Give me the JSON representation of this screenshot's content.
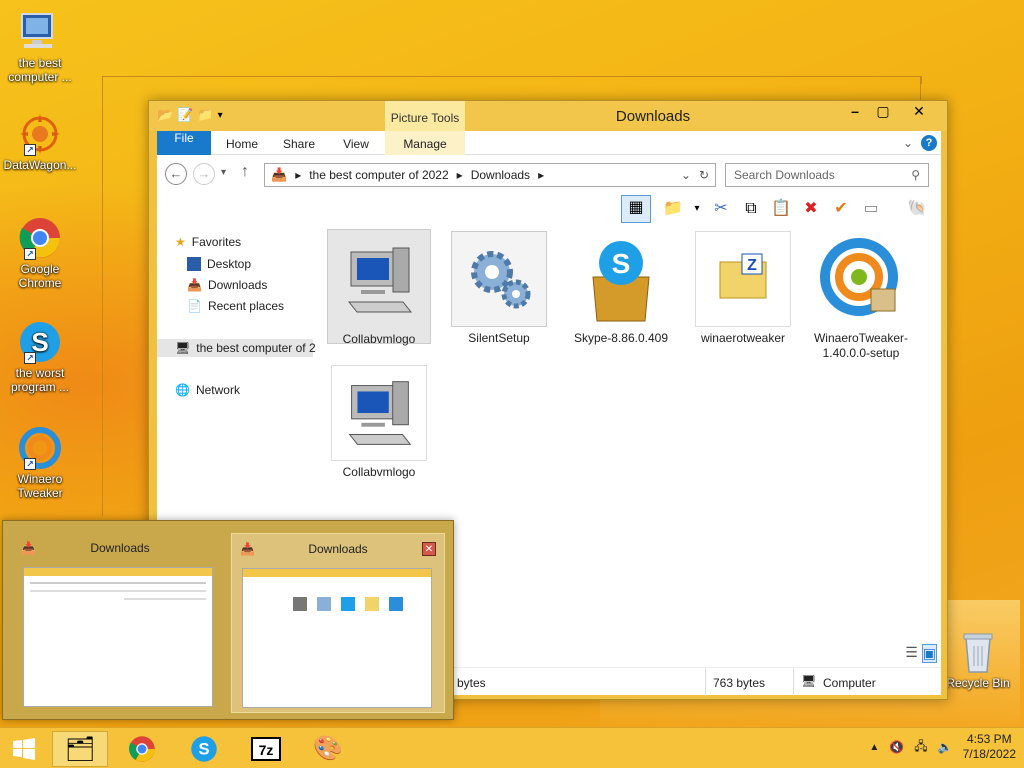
{
  "desktop": {
    "icons": [
      {
        "label": "the best computer ..."
      },
      {
        "label": "DataWagon..."
      },
      {
        "label": "Google Chrome"
      },
      {
        "label": "the worst program ..."
      },
      {
        "label": "Winaero Tweaker"
      }
    ],
    "recycle_bin": "Recycle Bin"
  },
  "window": {
    "title": "Downloads",
    "context_group": "Picture Tools",
    "tabs": [
      "File",
      "Home",
      "Share",
      "View",
      "Manage"
    ],
    "address": {
      "segments": [
        "the best computer of 2022",
        "Downloads"
      ]
    },
    "search_placeholder": "Search Downloads",
    "nav": {
      "favorites": "Favorites",
      "items": [
        "Desktop",
        "Downloads",
        "Recent places"
      ],
      "computer": "the best computer of 2",
      "network": "Network"
    },
    "files": [
      {
        "name": "Collabvmlogo"
      },
      {
        "name": "SilentSetup"
      },
      {
        "name": "Skype-8.86.0.409"
      },
      {
        "name": "winaerotweaker"
      },
      {
        "name": "WinaeroTweaker-1.40.0.0-setup"
      },
      {
        "name": "Collabvmlogo"
      }
    ],
    "status": {
      "left": "bytes",
      "size": "763 bytes",
      "location": "Computer"
    }
  },
  "preview": {
    "windows": [
      {
        "title": "Downloads"
      },
      {
        "title": "Downloads"
      }
    ]
  },
  "taskbar": {
    "time": "4:53 PM",
    "date": "7/18/2022"
  },
  "colors": {
    "accent": "#1979ca",
    "desktop": "#f3b114",
    "window_frame": "#f2c64a"
  }
}
